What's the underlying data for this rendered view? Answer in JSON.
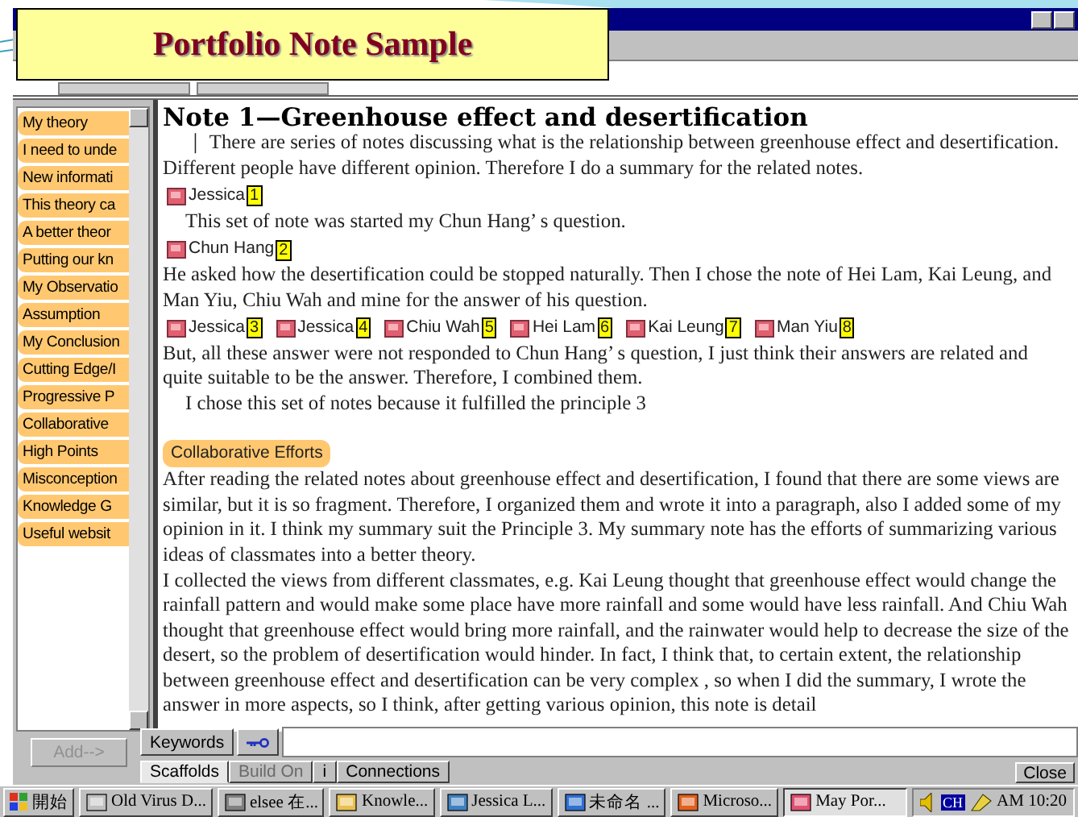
{
  "banner": {
    "title": "Portfolio Note Sample"
  },
  "sidebar": {
    "items": [
      {
        "label": "My theory"
      },
      {
        "label": "I need to unde"
      },
      {
        "label": "New informati"
      },
      {
        "label": "This theory ca"
      },
      {
        "label": "A better theor"
      },
      {
        "label": "Putting our kn"
      },
      {
        "label": "My Observatio"
      },
      {
        "label": "Assumption"
      },
      {
        "label": "My Conclusion"
      },
      {
        "label": "Cutting Edge/I"
      },
      {
        "label": "Progressive P"
      },
      {
        "label": "Collaborative"
      },
      {
        "label": "High Points"
      },
      {
        "label": "Misconception"
      },
      {
        "label": "Knowledge G"
      },
      {
        "label": "Useful websit"
      }
    ]
  },
  "note": {
    "title": "Note 1—Greenhouse effect and desertification",
    "blocks": [
      {
        "kind": "indented",
        "text": "｜ There are series of notes discussing what is the relationship between greenhouse effect and desertification. Different people have different opinion. Therefore I do a summary for the related notes."
      },
      {
        "kind": "refs",
        "refs": [
          {
            "author": "Jessica",
            "number": "1"
          }
        ]
      },
      {
        "kind": "indented",
        "text": "This set of note was started my Chun Hang’ s question."
      },
      {
        "kind": "refs",
        "refs": [
          {
            "author": "Chun Hang",
            "number": "2"
          }
        ]
      },
      {
        "kind": "text",
        "text": "He asked how the desertification could be stopped naturally. Then I chose the note of Hei Lam, Kai Leung, and Man Yiu, Chiu Wah and mine for the answer of his question."
      },
      {
        "kind": "refs",
        "refs": [
          {
            "author": "Jessica",
            "number": "3"
          },
          {
            "author": "Jessica",
            "number": "4"
          },
          {
            "author": "Chiu Wah",
            "number": "5"
          },
          {
            "author": "Hei Lam",
            "number": "6"
          },
          {
            "author": "Kai Leung",
            "number": "7"
          },
          {
            "author": "Man Yiu",
            "number": "8"
          }
        ]
      },
      {
        "kind": "text",
        "text": "But, all these answer were not responded to Chun Hang’ s question, I just think their answers are related and quite suitable to be the answer. Therefore, I combined them."
      },
      {
        "kind": "indented",
        "text": "I chose this set of notes because it fulfilled the principle 3"
      },
      {
        "kind": "scaffold",
        "tag": "Collaborative Efforts",
        "text": "After reading the related notes about greenhouse effect and desertification, I found that there are some views are similar, but it is so fragment. Therefore, I organized them and wrote it into a paragraph, also I added some of my opinion in it. I think my summary suit the Principle 3. My summary note has the efforts of summarizing various ideas of classmates into a better theory."
      },
      {
        "kind": "text",
        "text": "I collected the views from different classmates, e.g. Kai Leung thought that greenhouse effect would change the rainfall pattern and would make some place have more rainfall and some would have less rainfall. And Chiu Wah thought that greenhouse effect would bring more rainfall, and the rainwater would help to decrease the size of the desert, so the problem of desertification would hinder. In fact, I think that, to certain extent, the relationship between greenhouse effect and desertification can be very complex , so when I did the summary, I wrote the answer in more aspects, so I think, after getting various opinion, this note is detail"
      }
    ]
  },
  "bottom": {
    "add_button": {
      "label": "Add-->",
      "disabled": true
    },
    "keywords_button": "Keywords",
    "tabs": [
      {
        "label": "Scaffolds",
        "selected": true,
        "disabled": false
      },
      {
        "label": "Build On",
        "selected": false,
        "disabled": true
      },
      {
        "label": "i",
        "selected": false,
        "disabled": false
      },
      {
        "label": "Connections",
        "selected": false,
        "disabled": false
      }
    ],
    "close_button": "Close"
  },
  "taskbar": {
    "start": "開始",
    "tasks": [
      {
        "label": "Old Virus D...",
        "selected": false
      },
      {
        "label": "elsee 在...",
        "selected": false
      },
      {
        "label": "Knowle...",
        "selected": false
      },
      {
        "label": "Jessica L...",
        "selected": false
      },
      {
        "label": "未命名 ...",
        "selected": false
      },
      {
        "label": "Microso...",
        "selected": false
      },
      {
        "label": "May Por...",
        "selected": true
      }
    ],
    "ime": "CH",
    "clock": "AM 10:20"
  }
}
